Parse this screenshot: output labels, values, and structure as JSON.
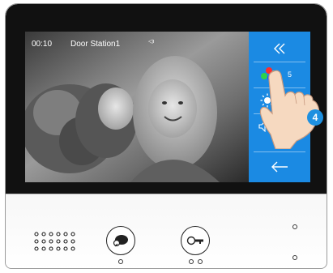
{
  "status_bar": {
    "time": "00:10",
    "station": "Door Station1",
    "volume_icon": "speaker-icon"
  },
  "sidebar": {
    "collapse_icon": "double-chevron-left-icon",
    "color_icon": "color-dots-icon",
    "color_value": "5",
    "brightness_icon": "sun-icon",
    "volume_icon": "speaker-volume-icon",
    "volume_value": "6",
    "back_icon": "arrow-left-icon",
    "accent": "#1b8ae3"
  },
  "badge": "4",
  "panel": {
    "talk_icon": "talk-bubble-icon",
    "unlock_icon": "key-icon"
  }
}
